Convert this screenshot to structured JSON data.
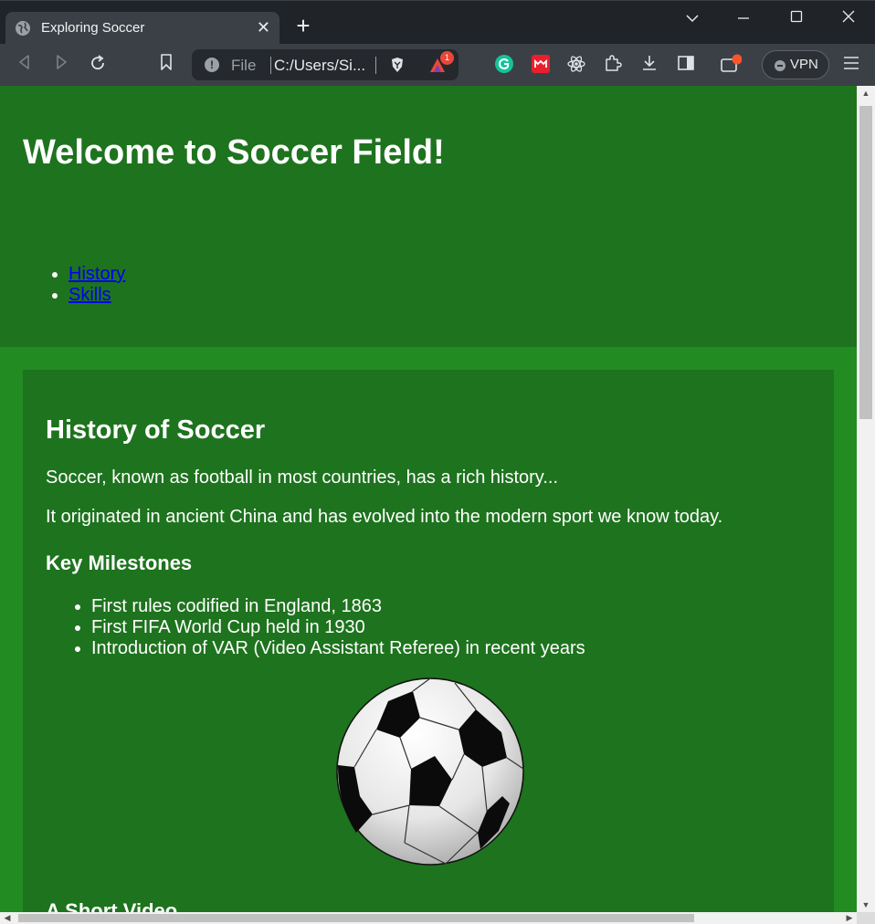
{
  "browser": {
    "tab_title": "Exploring Soccer",
    "close_glyph": "✕",
    "new_tab_glyph": "+",
    "address": {
      "scheme_label": "File",
      "url": "C:/Users/Si..."
    },
    "badge_count": "1",
    "vpn_label": "VPN",
    "accent_colors": {
      "chrome_dark": "#202428",
      "toolbar": "#3b4046",
      "grammarly": "#15c39a",
      "brave_orange": "#fb542b"
    }
  },
  "page": {
    "colors": {
      "background": "#228b22",
      "panel": "#1e731e",
      "link": "#0000ee",
      "text": "#ffffff"
    },
    "header": {
      "title": "Welcome to Soccer Field!",
      "nav": [
        "History",
        "Skills"
      ]
    },
    "history": {
      "title": "History of Soccer",
      "paragraphs": [
        "Soccer, known as football in most countries, has a rich history...",
        "It originated in ancient China and has evolved into the modern sport we know today."
      ],
      "milestones_title": "Key Milestones",
      "milestones": [
        "First rules codified in England, 1863",
        "First FIFA World Cup held in 1930",
        "Introduction of VAR (Video Assistant Referee) in recent years"
      ],
      "image_icon": "soccer-ball"
    },
    "video": {
      "title": "A Short Video"
    }
  }
}
